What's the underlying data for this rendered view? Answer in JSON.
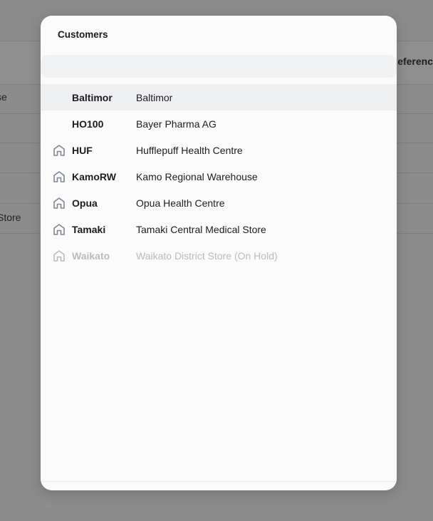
{
  "background": {
    "header_text": "eferenc",
    "cells": [
      "se",
      "e",
      "Store"
    ]
  },
  "modal": {
    "title": "Customers",
    "search": {
      "placeholder": ""
    },
    "customers": [
      {
        "code": "Baltimor",
        "name": "Baltimor",
        "icon": "none",
        "selected": true,
        "on_hold": false
      },
      {
        "code": "HO100",
        "name": "Bayer Pharma AG",
        "icon": "none",
        "selected": false,
        "on_hold": false
      },
      {
        "code": "HUF",
        "name": "Hufflepuff Health Centre",
        "icon": "home-icon",
        "selected": false,
        "on_hold": false
      },
      {
        "code": "KamoRW",
        "name": "Kamo Regional Warehouse",
        "icon": "home-icon",
        "selected": false,
        "on_hold": false
      },
      {
        "code": "Opua",
        "name": "Opua Health Centre",
        "icon": "home-icon",
        "selected": false,
        "on_hold": false
      },
      {
        "code": "Tamaki",
        "name": "Tamaki Central Medical Store",
        "icon": "home-icon",
        "selected": false,
        "on_hold": false
      },
      {
        "code": "Waikato",
        "name": "Waikato District Store (On Hold)",
        "icon": "home-icon",
        "selected": false,
        "on_hold": true
      }
    ]
  },
  "colors": {
    "overlay": "#8c8c8c",
    "modal_bg": "#fbfbfb",
    "selected_row": "#eeeff1",
    "icon": "#7f8694",
    "disabled": "#b9bbc0"
  }
}
